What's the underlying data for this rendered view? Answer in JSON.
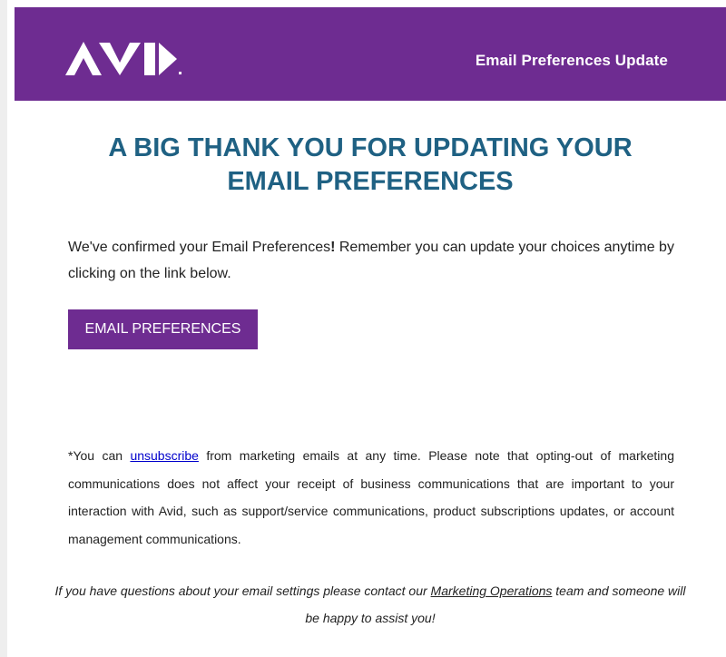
{
  "header": {
    "logo_text": "AVID",
    "title": "Email Preferences Update",
    "background_color": "#6e2c91"
  },
  "main": {
    "headline_line1": "A BIG THANK YOU FOR UPDATING YOUR",
    "headline_line2": "EMAIL PREFERENCES",
    "intro_part1": "We've confirmed your Email Preferences",
    "intro_exclaim": "!",
    "intro_part2": "  Remember you can update your choices anytime by clicking on the link below.",
    "cta_label": "EMAIL PREFERENCES"
  },
  "footer": {
    "disclaimer_before_link": "*You can ",
    "unsubscribe_link": "unsubscribe",
    "disclaimer_after_link": " from marketing emails at any time. Please note that opting-out of marketing communications does not affect your receipt of business communications that are important to your interaction with Avid, such as support/service communications, product subscriptions updates, or account management communications.",
    "contact_before_link": "If you have questions about your email settings please contact our ",
    "contact_link": "Marketing Operations",
    "contact_after_link": " team and someone will be happy to assist you!"
  }
}
